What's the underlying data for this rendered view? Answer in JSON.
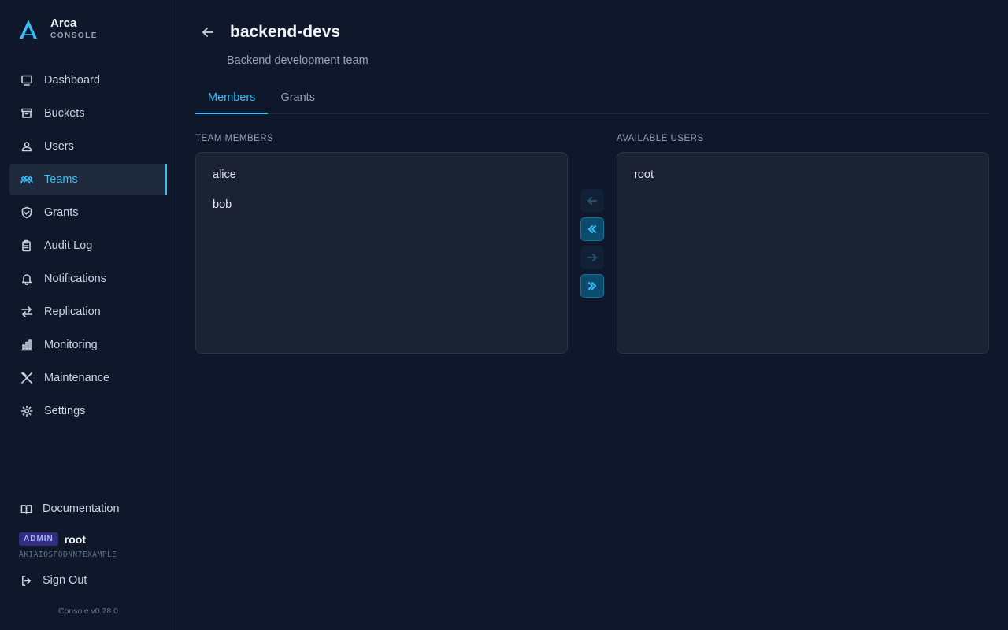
{
  "brand": {
    "name": "Arca",
    "subtitle": "CONSOLE"
  },
  "sidebar": {
    "items": [
      {
        "label": "Dashboard",
        "icon": "dashboard-icon"
      },
      {
        "label": "Buckets",
        "icon": "bucket-icon"
      },
      {
        "label": "Users",
        "icon": "user-icon"
      },
      {
        "label": "Teams",
        "icon": "team-icon",
        "active": true
      },
      {
        "label": "Grants",
        "icon": "shield-icon"
      },
      {
        "label": "Audit Log",
        "icon": "clipboard-icon"
      },
      {
        "label": "Notifications",
        "icon": "bell-icon"
      },
      {
        "label": "Replication",
        "icon": "arrows-exchange-icon"
      },
      {
        "label": "Monitoring",
        "icon": "bar-chart-icon"
      },
      {
        "label": "Maintenance",
        "icon": "tools-icon"
      },
      {
        "label": "Settings",
        "icon": "gear-icon"
      }
    ],
    "documentation": "Documentation",
    "user": {
      "role": "ADMIN",
      "name": "root",
      "access_key": "AKIAIOSFODNN7EXAMPLE"
    },
    "sign_out": "Sign Out",
    "version": "Console v0.28.0"
  },
  "page": {
    "title": "backend-devs",
    "description": "Backend development team",
    "tabs": [
      {
        "label": "Members",
        "active": true
      },
      {
        "label": "Grants",
        "active": false
      }
    ]
  },
  "members": {
    "label": "Team Members",
    "items": [
      "alice",
      "bob"
    ]
  },
  "available": {
    "label": "Available Users",
    "items": [
      "root"
    ]
  },
  "colors": {
    "background": "#0f172a",
    "accent": "#38bdf8",
    "panel": "#1a2233",
    "badge_bg": "#312e81"
  }
}
